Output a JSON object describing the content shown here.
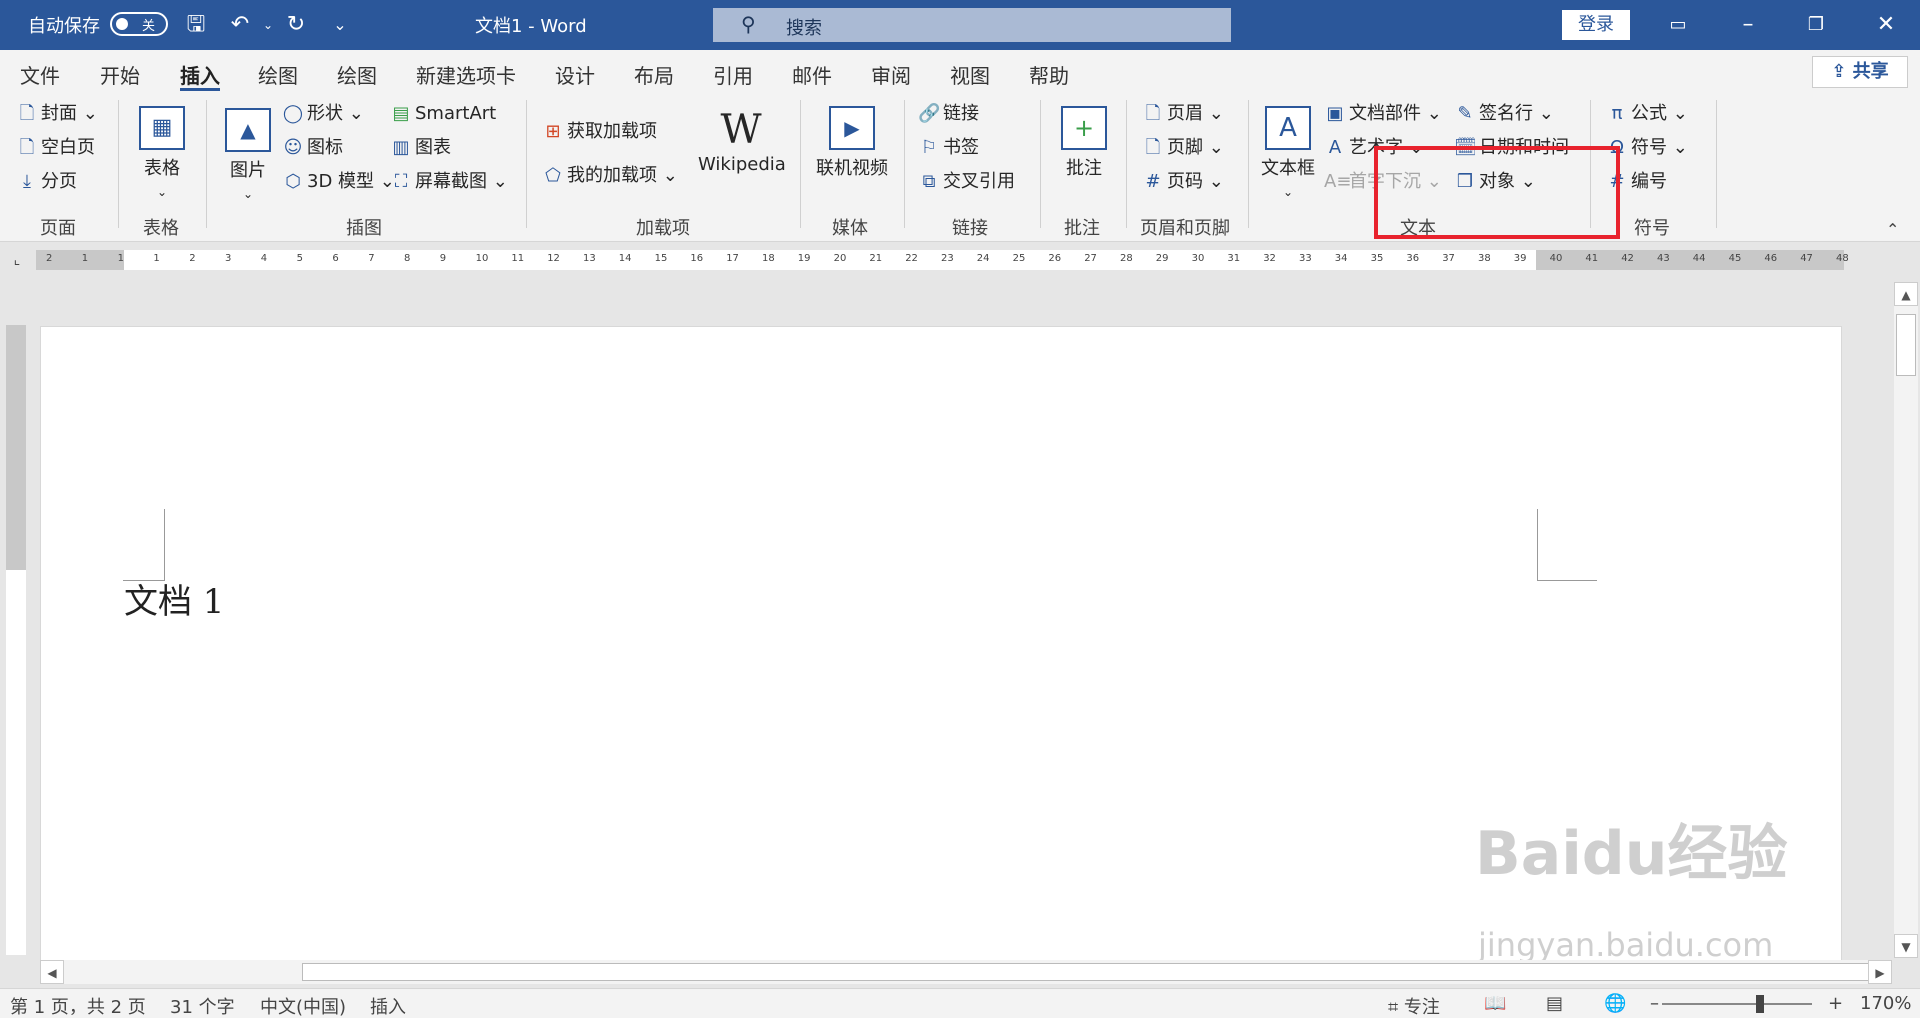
{
  "titlebar": {
    "autosave_label": "自动保存",
    "autosave_state": "关",
    "title": "文档1  -  Word",
    "search_placeholder": "搜索",
    "login_label": "登录"
  },
  "tabs": [
    "文件",
    "开始",
    "插入",
    "绘图",
    "绘图",
    "新建选项卡",
    "设计",
    "布局",
    "引用",
    "邮件",
    "审阅",
    "视图",
    "帮助"
  ],
  "share_label": "共享",
  "ribbon": {
    "pages": {
      "items": [
        "封面",
        "空白页",
        "分页"
      ],
      "group": "页面"
    },
    "table": {
      "label": "表格",
      "group": "表格"
    },
    "illustrations": {
      "picture": "图片",
      "items": [
        "形状",
        "图标",
        "3D 模型",
        "SmartArt",
        "图表",
        "屏幕截图"
      ],
      "group": "插图"
    },
    "addins": {
      "items": [
        "获取加载项",
        "我的加载项"
      ],
      "wikipedia": "Wikipedia",
      "group": "加载项"
    },
    "media": {
      "label": "联机视频",
      "group": "媒体"
    },
    "links": {
      "items": [
        "链接",
        "书签",
        "交叉引用"
      ],
      "group": "链接"
    },
    "comments": {
      "label": "批注",
      "group": "批注"
    },
    "header_footer": {
      "items": [
        "页眉",
        "页脚",
        "页码"
      ],
      "group": "页眉和页脚"
    },
    "text": {
      "textbox": "文本框",
      "items": [
        "文档部件",
        "艺术字",
        "首字下沉",
        "签名行",
        "日期和时间",
        "对象"
      ],
      "group": "文本"
    },
    "symbols": {
      "items": [
        "公式",
        "符号",
        "编号"
      ],
      "group": "符号"
    }
  },
  "ruler_marks": [
    "2",
    "1",
    "1",
    "1",
    "2",
    "3",
    "4",
    "5",
    "6",
    "7",
    "8",
    "9",
    "10",
    "11",
    "12",
    "13",
    "14",
    "15",
    "16",
    "17",
    "18",
    "19",
    "20",
    "21",
    "22",
    "23",
    "24",
    "25",
    "26",
    "27",
    "28",
    "29",
    "30",
    "31",
    "32",
    "33",
    "34",
    "35",
    "36",
    "37",
    "38",
    "39",
    "40",
    "41",
    "42",
    "43",
    "44",
    "45",
    "46",
    "47",
    "48"
  ],
  "document": {
    "text": "文档 1"
  },
  "watermark": {
    "brand": "Baidu经验",
    "url": "jingyan.baidu.com"
  },
  "status": {
    "page": "第 1 页，共 2 页",
    "words": "31 个字",
    "language": "中文(中国)",
    "mode": "插入",
    "focus": "专注",
    "zoom": "170%"
  },
  "colors": {
    "brand": "#2b579a",
    "highlight": "#e8222d"
  }
}
